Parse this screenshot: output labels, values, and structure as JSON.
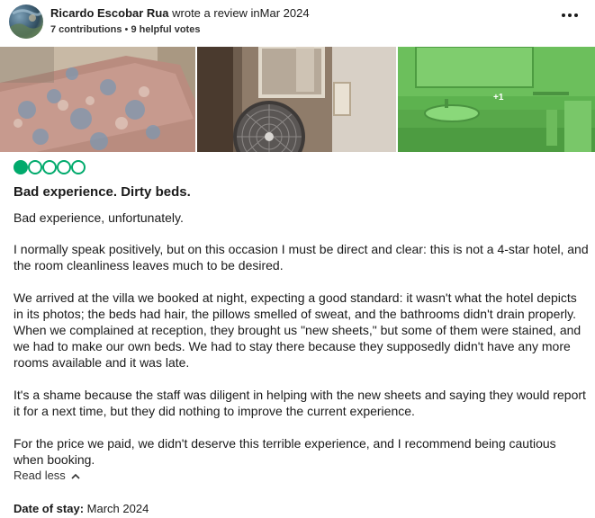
{
  "review": {
    "author_name": "Ricardo Escobar Rua",
    "wrote_text": "wrote a review in",
    "date": "Mar 2024",
    "contributions": "7 contributions",
    "separator": "•",
    "helpful_votes": "9 helpful votes",
    "more_options_icon": "ellipsis-icon",
    "photos": [
      {
        "name": "photo-bed",
        "description_icon": "bed-photo"
      },
      {
        "name": "photo-fan",
        "description_icon": "fan-photo"
      },
      {
        "name": "photo-bathroom",
        "description_icon": "bathroom-photo"
      }
    ],
    "more_photos_label": "+1",
    "rating": 1,
    "rating_max": 5,
    "rating_color": "#00aa6c",
    "title": "Bad experience. Dirty beds.",
    "paragraphs": [
      "Bad experience, unfortunately.",
      "I normally speak positively, but on this occasion I must be direct and clear: this is not a 4-star hotel, and the room cleanliness leaves much to be desired.",
      "We arrived at the villa we booked at night, expecting a good standard: it wasn't what the hotel depicts in its photos; the beds had hair, the pillows smelled of sweat, and the bathrooms didn't drain properly. When we complained at reception, they brought us \"new sheets,\" but some of them were stained, and we had to make our own beds. We had to stay there because they supposedly didn't have any more rooms available and it was late.",
      "It's a shame because the staff was diligent in helping with the new sheets and saying they would report it for a next time, but they did nothing to improve the current experience.",
      "For the price we paid, we didn't deserve this terrible experience, and I recommend being cautious when booking."
    ],
    "read_less_label": "Read less",
    "read_less_icon": "chevron-up-icon",
    "date_of_stay_label": "Date of stay:",
    "date_of_stay_value": "March 2024"
  }
}
